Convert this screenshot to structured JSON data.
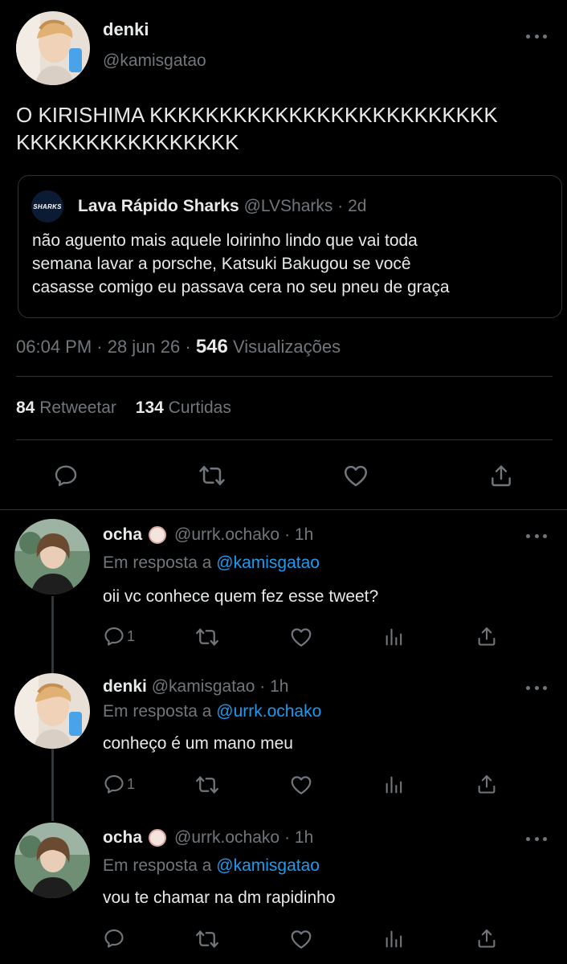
{
  "main_tweet": {
    "name": "denki",
    "handle": "@kamisgatao",
    "text_line1": "O KIRISHIMA KKKKKKKKKKKKKKKKKKKKKKKKK",
    "text_line2": "KKKKKKKKKKKKKKKK",
    "quoted": {
      "name": "Lava Rápido Sharks",
      "handle": "@LVSharks",
      "time": "· 2d",
      "logo_text": "SHARKS",
      "line1": "não aguento mais aquele loirinho lindo que vai toda",
      "line2": "semana lavar a porsche, Katsuki Bakugou se você",
      "line3": "casasse comigo eu passava cera no seu pneu de graça"
    },
    "timestamp": "06:04 PM · 28 jun 26 ·",
    "views_count": "546",
    "views_label": "Visualizações",
    "retweets_count": "84",
    "retweets_label": "Retweetar",
    "likes_count": "134",
    "likes_label": "Curtidas"
  },
  "replies": [
    {
      "name": "ocha",
      "handle": "@urrk.ochako",
      "time": "· 1h",
      "reply_prefix": "Em resposta a",
      "reply_to": "@kamisgatao",
      "text": "oii vc conhece quem fez esse tweet?",
      "reply_count": "1"
    },
    {
      "name": "denki",
      "handle": "@kamisgatao",
      "time": "· 1h",
      "reply_prefix": "Em resposta a",
      "reply_to": "@urrk.ochako",
      "text": "conheço é um mano meu",
      "reply_count": "1"
    },
    {
      "name": "ocha",
      "handle": "@urrk.ochako",
      "time": "· 1h",
      "reply_prefix": "Em resposta a",
      "reply_to": "@kamisgatao",
      "text": "vou te chamar na dm rapidinho",
      "reply_count": ""
    }
  ],
  "colors": {
    "background": "#000000",
    "text": "#e7e9ea",
    "secondary": "#71767b",
    "accent": "#1d9bf0",
    "divider": "#2f3336"
  },
  "icons": [
    "more-icon",
    "reply-icon",
    "retweet-icon",
    "like-icon",
    "share-icon",
    "views-icon",
    "badge-icon"
  ]
}
